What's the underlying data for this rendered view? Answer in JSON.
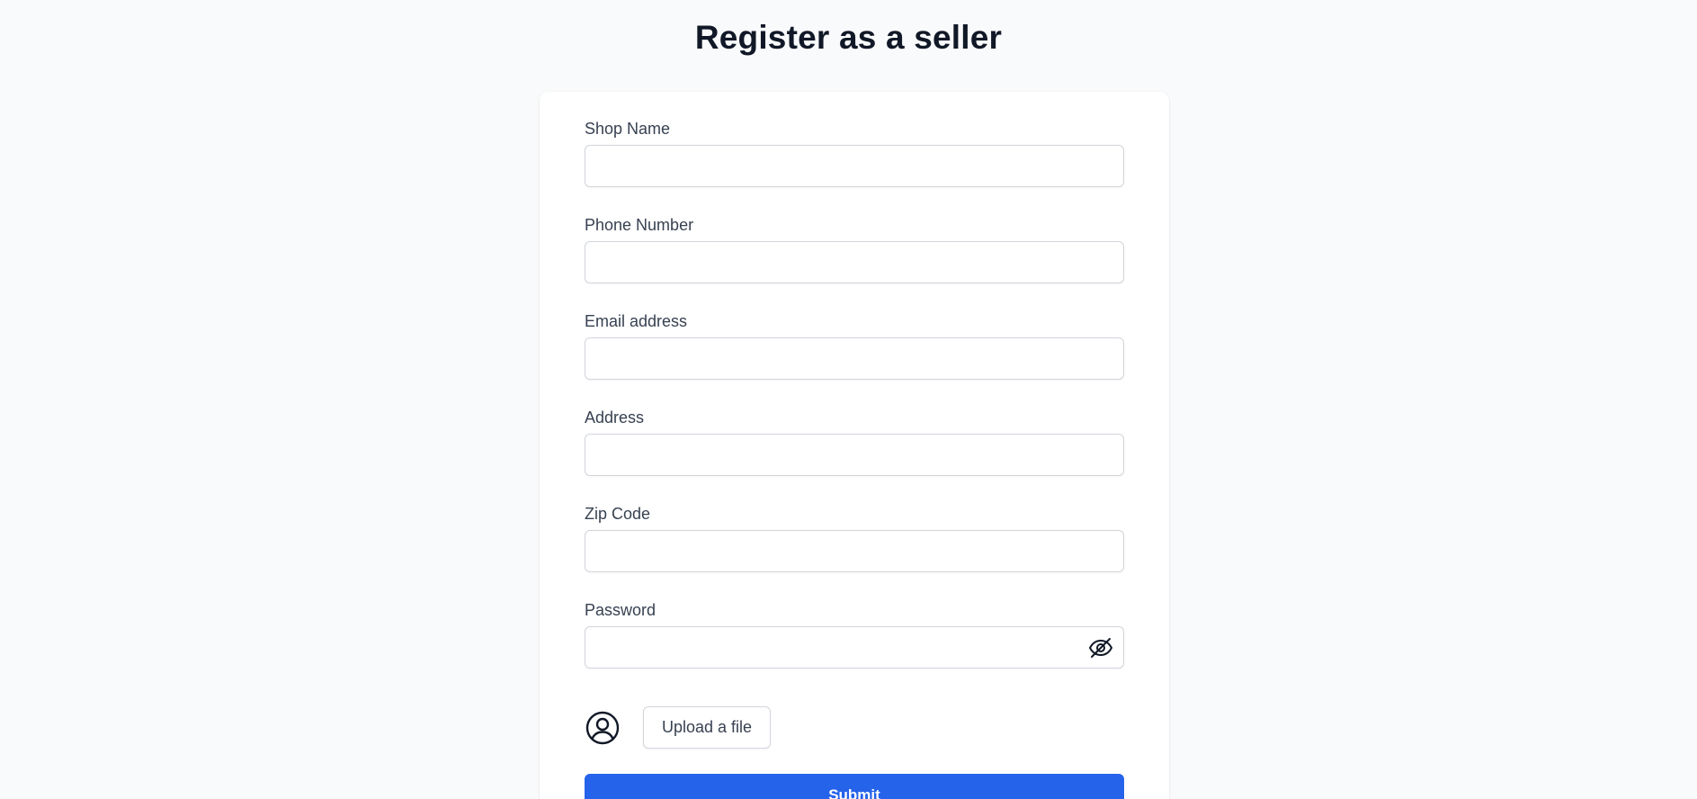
{
  "page": {
    "title": "Register as a seller"
  },
  "form": {
    "fields": [
      {
        "label": "Shop Name",
        "value": "",
        "placeholder": ""
      },
      {
        "label": "Phone Number",
        "value": "",
        "placeholder": ""
      },
      {
        "label": "Email address",
        "value": "",
        "placeholder": ""
      },
      {
        "label": "Address",
        "value": "",
        "placeholder": ""
      },
      {
        "label": "Zip Code",
        "value": "",
        "placeholder": ""
      },
      {
        "label": "Password",
        "value": "",
        "placeholder": ""
      }
    ],
    "password_toggle_icon": "eye-slash-icon",
    "avatar_icon": "user-circle-icon",
    "upload_label": "Upload a file",
    "submit_label": "Submit"
  },
  "colors": {
    "background": "#f9fafb",
    "card": "#ffffff",
    "accent": "#2563eb",
    "input_border": "#d1d5db",
    "label_text": "#374151",
    "title_text": "#111827"
  }
}
